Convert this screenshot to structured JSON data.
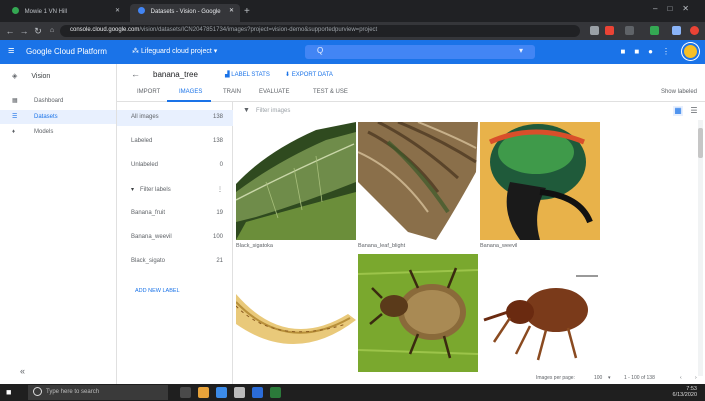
{
  "browser": {
    "tabs": [
      {
        "label": "Mowie 1 VN Hill",
        "active": false
      },
      {
        "label": "Datasets - Vision - Google",
        "active": true
      }
    ],
    "url_host": "console.cloud.google.com",
    "url_path": "/vision/datasets/ICN2047851734/images?project=vision-demo&supportedpurview=project"
  },
  "gcp": {
    "brand": "Google Cloud Platform",
    "project": "Lifeguard cloud project",
    "search_placeholder": "Q"
  },
  "leftnav": {
    "title": "Vision",
    "items": [
      {
        "label": "Dashboard",
        "icon": "dashboard-icon",
        "active": false
      },
      {
        "label": "Datasets",
        "icon": "list-icon",
        "active": true
      },
      {
        "label": "Models",
        "icon": "lightbulb-icon",
        "active": false
      }
    ],
    "collapse_glyph": "«"
  },
  "dataset": {
    "name": "banana_tree",
    "label_stats": "LABEL STATS",
    "export": "EXPORT DATA",
    "tabs": [
      "Import",
      "Images",
      "Train",
      "Evaluate",
      "Test & use"
    ],
    "active_tab": 1,
    "right_link": "Show labeled"
  },
  "labels": {
    "rows": [
      {
        "name": "All images",
        "count": "138",
        "selected": true
      },
      {
        "name": "Labeled",
        "count": "138",
        "selected": false
      },
      {
        "name": "Unlabeled",
        "count": "0",
        "selected": false
      },
      {
        "name": "Filter labels",
        "count": "",
        "selected": false,
        "filter": true
      },
      {
        "name": "Banana_fruit",
        "count": "19",
        "selected": false
      },
      {
        "name": "Banana_weevil",
        "count": "100",
        "selected": false
      },
      {
        "name": "Black_sigato",
        "count": "21",
        "selected": false
      }
    ],
    "add_label": "ADD NEW LABEL"
  },
  "gallery": {
    "filter_placeholder": "Filter images",
    "captions": [
      "Black_sigatoka",
      "Banana_leaf_blight",
      "Banana_weevil"
    ]
  },
  "pager": {
    "per_page_label": "Images per page:",
    "per_page": "100",
    "range": "1 - 100 of 138"
  },
  "taskbar": {
    "search_placeholder": "Type here to search",
    "time": "7:53",
    "date": "6/13/2020"
  },
  "colors": {
    "gcp_blue": "#1a73e8",
    "chrome_dark": "#202124",
    "taskbar": "#1f1f1f",
    "selected_bg": "#e8f0fe"
  }
}
